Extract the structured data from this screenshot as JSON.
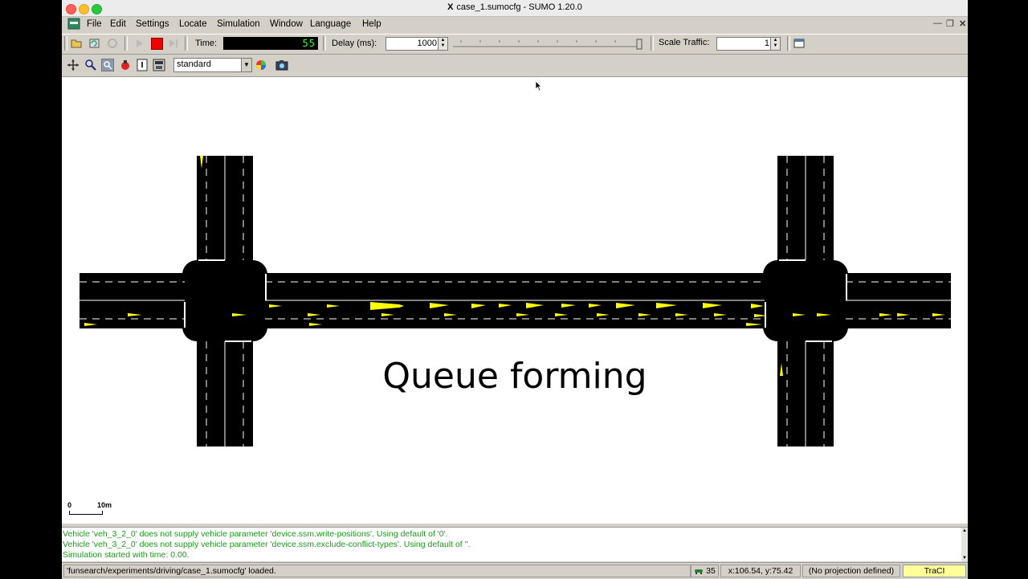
{
  "window": {
    "title": "case_1.sumocfg - SUMO 1.20.0",
    "x11_glyph": "X"
  },
  "menu": [
    "File",
    "Edit",
    "Settings",
    "Locate",
    "Simulation",
    "Window",
    "Language",
    "Help"
  ],
  "toolbar": {
    "time_label": "Time:",
    "time_value": "55",
    "delay_label": "Delay (ms):",
    "delay_value": "1000",
    "scale_label": "Scale Traffic:",
    "scale_value": "1"
  },
  "view": {
    "scheme": "standard"
  },
  "canvas": {
    "overlay_text": "Queue forming",
    "scale_start": "0",
    "scale_end": "10m"
  },
  "messages": [
    "Vehicle 'veh_3_2_0' does not supply vehicle parameter 'device.ssm.write-positions'. Using default of '0'.",
    "Vehicle 'veh_3_2_0' does not supply vehicle parameter 'device.ssm.exclude-conflict-types'. Using default of ''.",
    "Simulation started with time: 0.00."
  ],
  "status": {
    "main": "'funsearch/experiments/driving/case_1.sumocfg' loaded.",
    "vehicle_count": "35",
    "coords": "x:106.54, y:75.42",
    "projection": "(No projection defined)",
    "traci": "TraCI"
  },
  "colors": {
    "road": "#000000",
    "vehicle": "#ffff00",
    "time_digits": "#33ff33",
    "message_text": "#1a9a1a",
    "traci_bg": "#ffff99"
  }
}
